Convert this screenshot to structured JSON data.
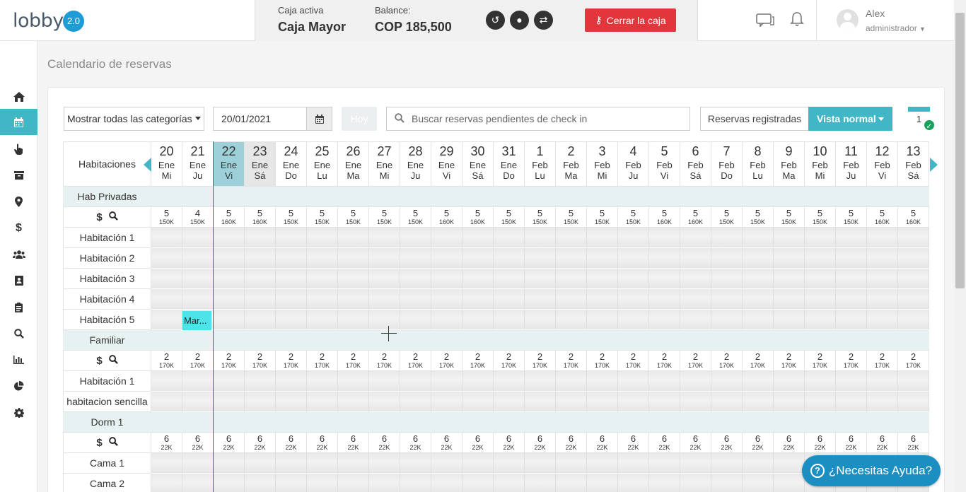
{
  "header": {
    "logo": "lobby",
    "version": "2.0",
    "caja_label": "Caja activa",
    "caja_value": "Caja Mayor",
    "balance_label": "Balance:",
    "balance_value": "COP 185,500",
    "close_label": "Cerrar la caja",
    "user_name": "Alex",
    "user_role": "administrador"
  },
  "sidebar": {
    "items": [
      {
        "icon": "home-icon"
      },
      {
        "icon": "calendar-icon",
        "active": true
      },
      {
        "icon": "hand-pointer-icon"
      },
      {
        "icon": "archive-icon"
      },
      {
        "icon": "map-marker-icon"
      },
      {
        "icon": "dollar-icon"
      },
      {
        "icon": "users-icon"
      },
      {
        "icon": "address-book-icon"
      },
      {
        "icon": "clipboard-icon"
      },
      {
        "icon": "search-icon"
      },
      {
        "icon": "bar-chart-icon"
      },
      {
        "icon": "pie-chart-icon"
      },
      {
        "icon": "gear-icon"
      }
    ]
  },
  "page_title": "Calendario de reservas",
  "toolbar": {
    "category_select": "Mostrar todas las categorías",
    "date_value": "20/01/2021",
    "today_label": "Hoy",
    "search_placeholder": "Buscar reservas pendientes de check in",
    "registered_label": "Reservas registradas",
    "view_label": "Vista normal",
    "calendar_count": "1"
  },
  "grid": {
    "rooms_header": "Habitaciones",
    "days": [
      {
        "n": "20",
        "m": "Ene",
        "w": "Mi"
      },
      {
        "n": "21",
        "m": "Ene",
        "w": "Ju"
      },
      {
        "n": "22",
        "m": "Ene",
        "w": "Vi",
        "today": true
      },
      {
        "n": "23",
        "m": "Ene",
        "w": "Sá",
        "next": true
      },
      {
        "n": "24",
        "m": "Ene",
        "w": "Do"
      },
      {
        "n": "25",
        "m": "Ene",
        "w": "Lu"
      },
      {
        "n": "26",
        "m": "Ene",
        "w": "Ma"
      },
      {
        "n": "27",
        "m": "Ene",
        "w": "Mi"
      },
      {
        "n": "28",
        "m": "Ene",
        "w": "Ju"
      },
      {
        "n": "29",
        "m": "Ene",
        "w": "Vi"
      },
      {
        "n": "30",
        "m": "Ene",
        "w": "Sá"
      },
      {
        "n": "31",
        "m": "Ene",
        "w": "Do"
      },
      {
        "n": "1",
        "m": "Feb",
        "w": "Lu"
      },
      {
        "n": "2",
        "m": "Feb",
        "w": "Ma"
      },
      {
        "n": "3",
        "m": "Feb",
        "w": "Mi"
      },
      {
        "n": "4",
        "m": "Feb",
        "w": "Ju"
      },
      {
        "n": "5",
        "m": "Feb",
        "w": "Vi"
      },
      {
        "n": "6",
        "m": "Feb",
        "w": "Sá"
      },
      {
        "n": "7",
        "m": "Feb",
        "w": "Do"
      },
      {
        "n": "8",
        "m": "Feb",
        "w": "Lu"
      },
      {
        "n": "9",
        "m": "Feb",
        "w": "Ma"
      },
      {
        "n": "10",
        "m": "Feb",
        "w": "Mi"
      },
      {
        "n": "11",
        "m": "Feb",
        "w": "Ju"
      },
      {
        "n": "12",
        "m": "Feb",
        "w": "Vi"
      },
      {
        "n": "13",
        "m": "Feb",
        "w": "Sá"
      }
    ],
    "categories": [
      {
        "name": "Hab Privadas",
        "availability": [
          "5",
          "4",
          "5",
          "5",
          "5",
          "5",
          "5",
          "5",
          "5",
          "5",
          "5",
          "5",
          "5",
          "5",
          "5",
          "5",
          "5",
          "5",
          "5",
          "5",
          "5",
          "5",
          "5",
          "5",
          "5"
        ],
        "prices": [
          "150K",
          "150K",
          "160K",
          "160K",
          "150K",
          "150K",
          "150K",
          "150K",
          "150K",
          "160K",
          "160K",
          "150K",
          "150K",
          "150K",
          "150K",
          "150K",
          "160K",
          "160K",
          "150K",
          "150K",
          "150K",
          "150K",
          "150K",
          "160K",
          "160K"
        ],
        "rooms": [
          "Habitación 1",
          "Habitación 2",
          "Habitación 3",
          "Habitación 4",
          "Habitación 5"
        ]
      },
      {
        "name": "Familiar",
        "availability": [
          "2",
          "2",
          "2",
          "2",
          "2",
          "2",
          "2",
          "2",
          "2",
          "2",
          "2",
          "2",
          "2",
          "2",
          "2",
          "2",
          "2",
          "2",
          "2",
          "2",
          "2",
          "2",
          "2",
          "2",
          "2"
        ],
        "prices": [
          "170K",
          "170K",
          "170K",
          "170K",
          "170K",
          "170K",
          "170K",
          "170K",
          "170K",
          "170K",
          "170K",
          "170K",
          "170K",
          "170K",
          "170K",
          "170K",
          "170K",
          "170K",
          "170K",
          "170K",
          "170K",
          "170K",
          "170K",
          "170K",
          "170K"
        ],
        "rooms": [
          "Habitación 1",
          "habitacion sencilla"
        ]
      },
      {
        "name": "Dorm 1",
        "availability": [
          "6",
          "6",
          "6",
          "6",
          "6",
          "6",
          "6",
          "6",
          "6",
          "6",
          "6",
          "6",
          "6",
          "6",
          "6",
          "6",
          "6",
          "6",
          "6",
          "6",
          "6",
          "6",
          "6",
          "6",
          "6"
        ],
        "prices": [
          "22K",
          "22K",
          "22K",
          "22K",
          "22K",
          "22K",
          "22K",
          "22K",
          "22K",
          "22K",
          "22K",
          "22K",
          "22K",
          "22K",
          "22K",
          "22K",
          "22K",
          "22K",
          "22K",
          "22K",
          "22K",
          "22K",
          "22K",
          "22K",
          "22K"
        ],
        "rooms": [
          "Cama 1",
          "Cama 2"
        ]
      }
    ],
    "booking_label": "Mar..."
  },
  "help_label": "¿Necesitas Ayuda?"
}
